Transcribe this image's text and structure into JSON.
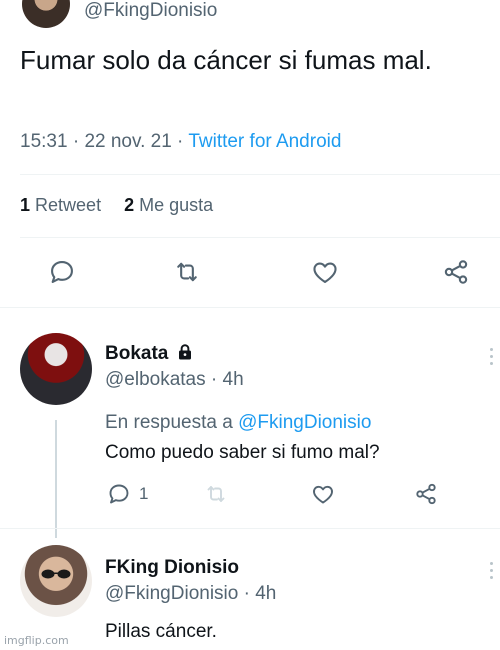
{
  "main_tweet": {
    "handle": "@FkingDionisio",
    "text": "Fumar solo da cáncer si fumas mal.",
    "time": "15:31",
    "separator": "·",
    "date": "22 nov. 21",
    "source": "Twitter for Android",
    "retweets": "1",
    "retweets_label": "Retweet",
    "likes": "2",
    "likes_label": "Me gusta"
  },
  "replies": [
    {
      "name": "Bokata",
      "handle": "@elbokatas",
      "time_sep": "·",
      "time": "4h",
      "reply_prefix": "En respuesta a",
      "reply_mention": "@FkingDionisio",
      "text": "Como puedo saber si fumo mal?",
      "reply_count": "1"
    },
    {
      "name": "FKing Dionisio",
      "handle": "@FkingDionisio",
      "time_sep": "·",
      "time": "4h",
      "text": "Pillas cáncer."
    }
  ],
  "watermark": "imgflip.com",
  "colors": {
    "accent": "#1d9bf0",
    "secondary_text": "#536471",
    "primary_text": "#0f1419"
  },
  "icons": [
    "reply-icon",
    "retweet-icon",
    "like-icon",
    "share-icon",
    "lock-icon",
    "more-icon"
  ]
}
